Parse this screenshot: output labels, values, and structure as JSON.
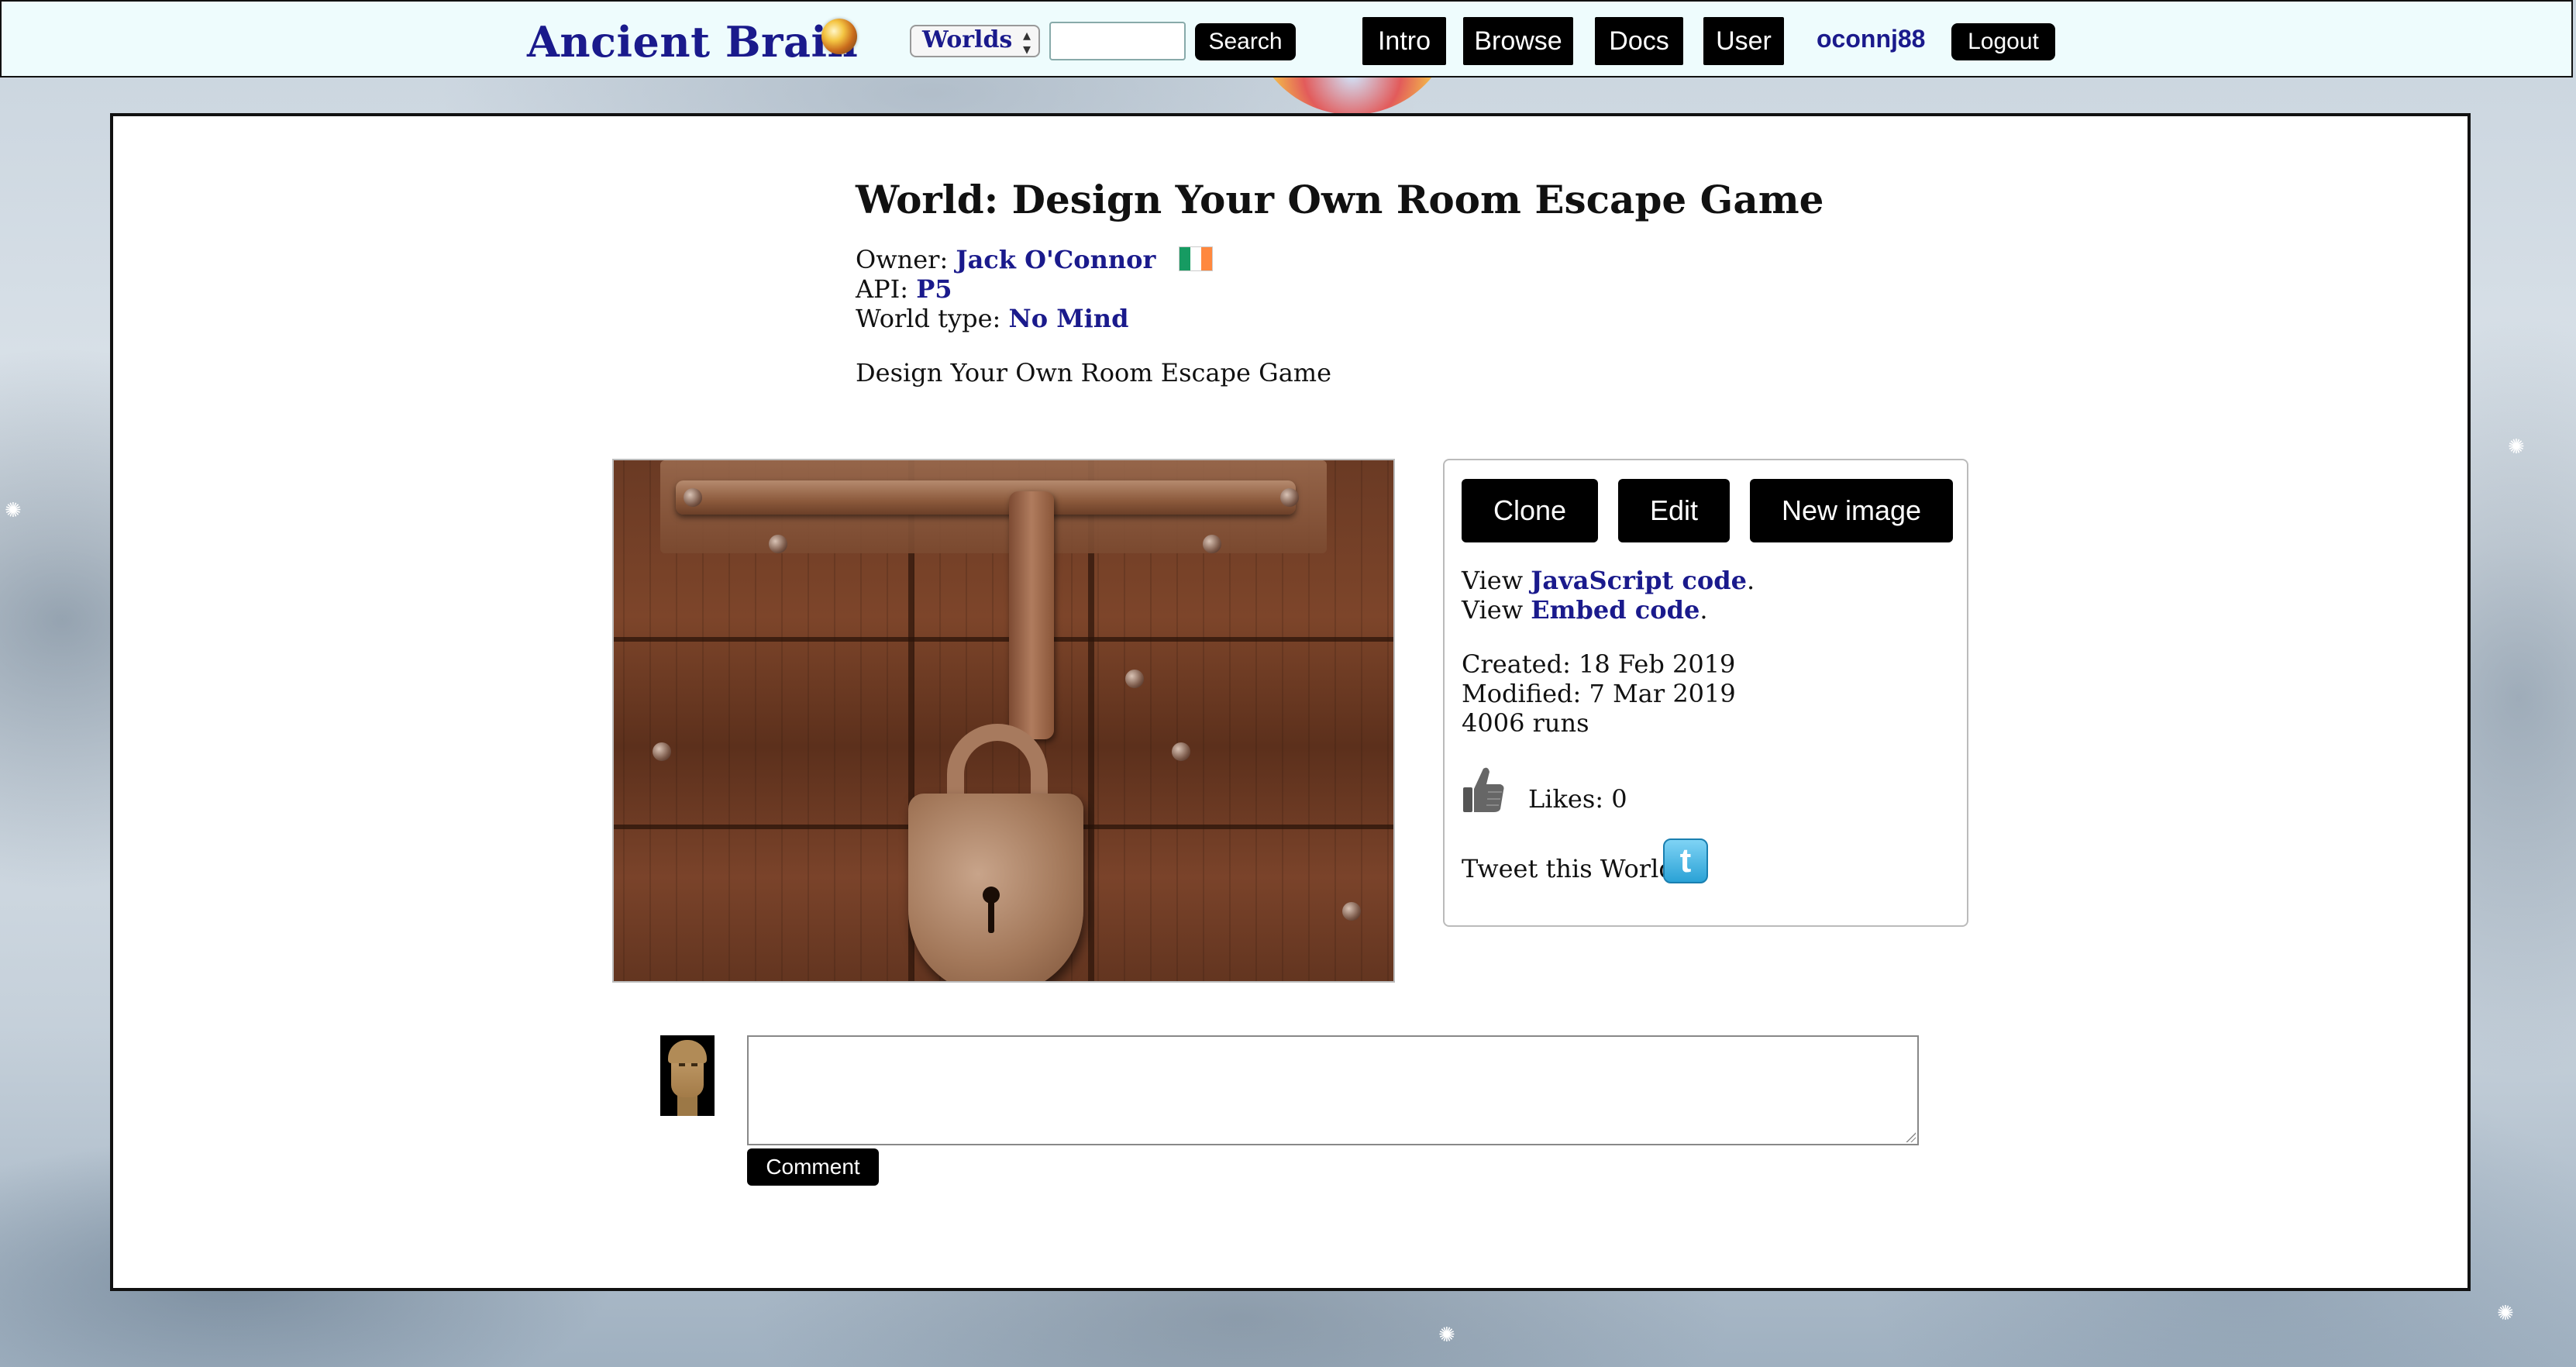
{
  "topbar": {
    "logo": "Ancient Brain",
    "select_value": "Worlds",
    "search_placeholder": "",
    "search_label": "Search",
    "nav": [
      "Intro",
      "Browse",
      "Docs",
      "User"
    ],
    "username": "oconnj88",
    "logout_label": "Logout"
  },
  "world": {
    "title": "World: Design Your Own Room Escape Game",
    "owner_label": "Owner:",
    "owner": "Jack O'Connor",
    "api_label": "API:",
    "api": "P5",
    "type_label": "World type:",
    "type": "No Mind",
    "description": "Design Your Own Room Escape Game"
  },
  "actions": {
    "clone": "Clone",
    "edit": "Edit",
    "new_image": "New image"
  },
  "info": {
    "view_prefix": "View",
    "js_link": "JavaScript code",
    "embed_link": "Embed code",
    "created": "Created: 18 Feb 2019",
    "modified": "Modified: 7 Mar 2019",
    "runs": "4006 runs",
    "likes": "Likes: 0",
    "tweet": "Tweet this World:"
  },
  "comment": {
    "placeholder": "",
    "button": "Comment"
  },
  "icons": {
    "logo": "brain-orb-icon",
    "flag": "ireland-flag-icon",
    "like": "thumbs-up-icon",
    "tweet": "twitter-icon",
    "avatar": "user-avatar"
  }
}
